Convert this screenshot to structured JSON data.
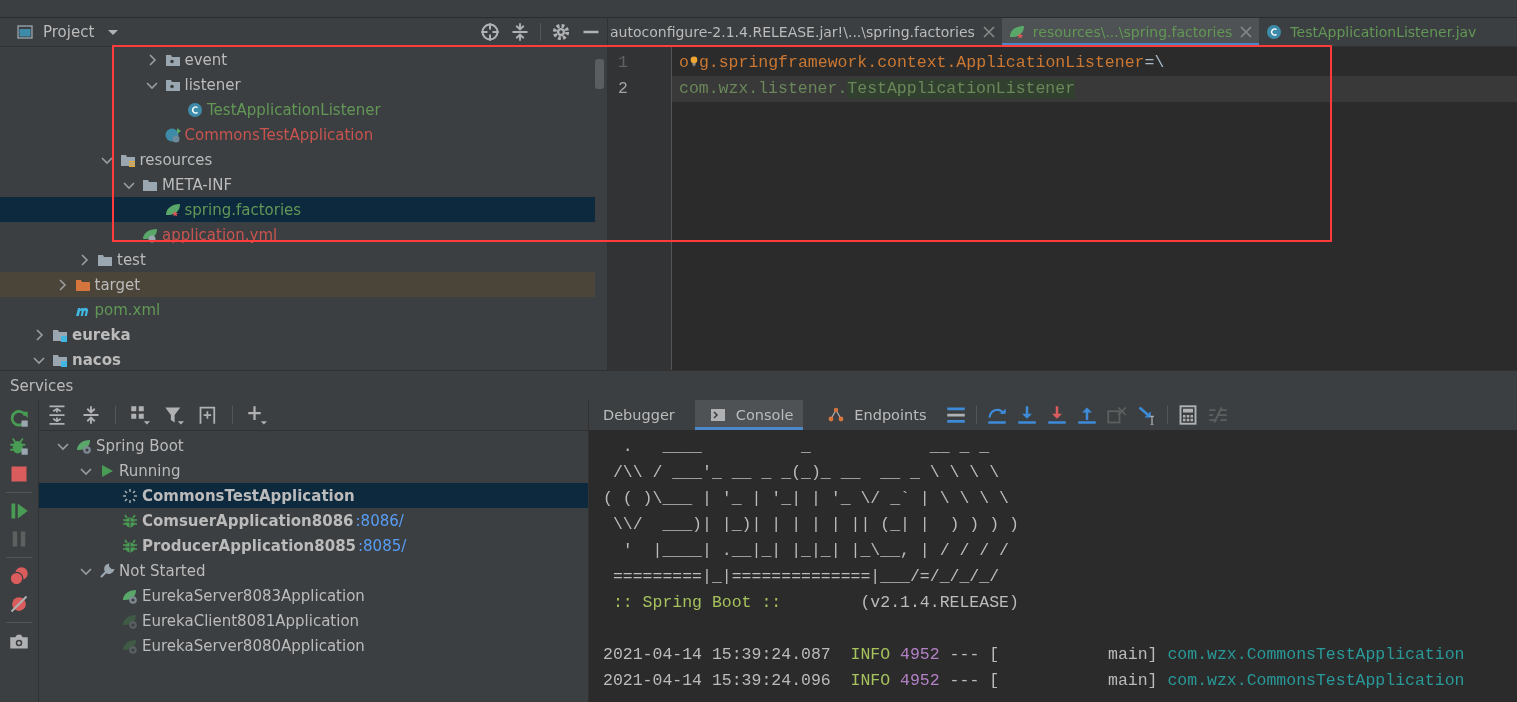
{
  "project_panel": {
    "title": "Project",
    "tree": [
      {
        "children": [
          {
            "children": [
              {
                "children": [
                  {
                    "children": [
                      {
                        "children": [
                          {
                            "label": "event",
                            "kind": "package",
                            "expanded": false,
                            "selected": false
                          },
                          {
                            "label": "listener",
                            "kind": "package",
                            "expanded": true,
                            "selected": false,
                            "children": [
                              {
                                "label": "TestApplicationListener",
                                "kind": "class",
                                "selected": false,
                                "color": "#629755"
                              }
                            ]
                          },
                          {
                            "label": "CommonsTestApplication",
                            "kind": "boot-class",
                            "selected": false,
                            "color": "#c75450"
                          }
                        ]
                      }
                    ]
                  },
                  {
                    "label": "resources",
                    "kind": "resources-folder",
                    "expanded": true,
                    "selected": false,
                    "children": [
                      {
                        "label": "META-INF",
                        "kind": "folder",
                        "expanded": true,
                        "selected": false,
                        "children": [
                          {
                            "label": "spring.factories",
                            "kind": "spring-file",
                            "selected": true,
                            "color": "#629755"
                          }
                        ]
                      },
                      {
                        "label": "application.yml",
                        "kind": "yml-file",
                        "selected": false,
                        "color": "#c75450"
                      }
                    ]
                  }
                ]
              },
              {
                "label": "test",
                "kind": "folder",
                "expanded": false,
                "selected": false
              }
            ]
          },
          {
            "label": "target",
            "kind": "excluded-folder",
            "expanded": false,
            "selected": false
          },
          {
            "label": "pom.xml",
            "kind": "maven-file",
            "selected": false,
            "color": "#629755"
          }
        ]
      },
      {
        "label": "eureka",
        "kind": "module",
        "expanded": false,
        "selected": false
      },
      {
        "label": "nacos",
        "kind": "module",
        "expanded": true,
        "selected": false
      }
    ]
  },
  "editor": {
    "tabs": [
      {
        "label": "autoconfigure-2.1.4.RELEASE.jar!\\...\\spring.factories",
        "kind": "plain",
        "selected": false,
        "closable": true
      },
      {
        "label": "resources\\...\\spring.factories",
        "kind": "spring",
        "selected": true,
        "closable": true
      },
      {
        "label": "TestApplicationListener.jav",
        "kind": "class",
        "selected": false,
        "closable": false
      }
    ],
    "lines": [
      {
        "number": "1",
        "current": false,
        "tokens": [
          {
            "text": "o",
            "kind": "key"
          },
          {
            "kind": "bulb"
          },
          {
            "text": "g.springframework.context.ApplicationListener",
            "kind": "key"
          },
          {
            "text": "=\\",
            "kind": "plain"
          }
        ]
      },
      {
        "number": "2",
        "current": true,
        "tokens": [
          {
            "text": "com.wzx.listener.",
            "kind": "value"
          },
          {
            "text": "TestApplicationListener",
            "kind": "value-match"
          }
        ]
      }
    ]
  },
  "services": {
    "title": "Services",
    "tree": [
      {
        "label": "Spring Boot",
        "kind": "spring-boot",
        "expanded": true,
        "selected": false,
        "children": [
          {
            "label": "Running",
            "kind": "running",
            "expanded": true,
            "selected": false,
            "children": [
              {
                "label": "CommonsTestApplication",
                "kind": "starting-app",
                "selected": true
              },
              {
                "label": "ComsuerApplication8086",
                "kind": "debug-app",
                "selected": false,
                "link": ":8086/"
              },
              {
                "label": "ProducerApplication8085",
                "kind": "debug-app",
                "selected": false,
                "link": ":8085/"
              }
            ]
          },
          {
            "label": "Not Started",
            "kind": "not-started",
            "expanded": true,
            "selected": false,
            "children": [
              {
                "label": "EurekaServer8083Application",
                "kind": "boot-app",
                "selected": false
              },
              {
                "label": "EurekaClient8081Application",
                "kind": "boot-app-dim",
                "selected": false
              },
              {
                "label": "EurekaServer8080Application",
                "kind": "boot-app-dim",
                "selected": false
              }
            ]
          }
        ]
      }
    ]
  },
  "console": {
    "tabs": [
      {
        "label": "Debugger",
        "kind": "plain",
        "selected": false
      },
      {
        "label": "Console",
        "kind": "console",
        "selected": true
      },
      {
        "label": "Endpoints",
        "kind": "endpoints",
        "selected": false
      }
    ],
    "lines": [
      {
        "kind": "output",
        "tokens": [
          {
            "text": "  .   ____          _            __ _ _",
            "kind": "text"
          }
        ]
      },
      {
        "kind": "output",
        "tokens": [
          {
            "text": " /\\\\ / ___'_ __ _ _(_)_ __  __ _ \\ \\ \\ \\",
            "kind": "text"
          }
        ]
      },
      {
        "kind": "output",
        "tokens": [
          {
            "text": "( ( )\\___ | '_ | '_| | '_ \\/ _` | \\ \\ \\ \\",
            "kind": "text"
          }
        ]
      },
      {
        "kind": "output",
        "tokens": [
          {
            "text": " \\\\/  ___)| |_)| | | | | || (_| |  ) ) ) )",
            "kind": "text"
          }
        ]
      },
      {
        "kind": "output",
        "tokens": [
          {
            "text": "  '  |____| .__|_| |_|_| |_\\__, | / / / /",
            "kind": "text"
          }
        ]
      },
      {
        "kind": "output",
        "tokens": [
          {
            "text": " =========|_|==============|___/=/_/_/_/",
            "kind": "text"
          }
        ]
      },
      {
        "kind": "output",
        "tokens": [
          {
            "text": " :: Spring Boot ::",
            "kind": "banner-label"
          },
          {
            "text": "        (v2.1.4.RELEASE)",
            "kind": "text"
          }
        ]
      },
      {
        "kind": "blank"
      },
      {
        "kind": "output",
        "tokens": [
          {
            "text": "2021-04-14 15:39:24.087  ",
            "kind": "text"
          },
          {
            "text": "INFO",
            "kind": "level"
          },
          {
            "text": " 4952",
            "kind": "pid"
          },
          {
            "text": " --- [           main] ",
            "kind": "text"
          },
          {
            "text": "com.wzx.CommonsTestApplication",
            "kind": "logger"
          }
        ]
      },
      {
        "kind": "output",
        "tokens": [
          {
            "text": "2021-04-14 15:39:24.096  ",
            "kind": "text"
          },
          {
            "text": "INFO",
            "kind": "level"
          },
          {
            "text": " 4952",
            "kind": "pid"
          },
          {
            "text": " --- [           main] ",
            "kind": "text"
          },
          {
            "text": "com.wzx.CommonsTestApplication",
            "kind": "logger"
          }
        ]
      }
    ]
  }
}
